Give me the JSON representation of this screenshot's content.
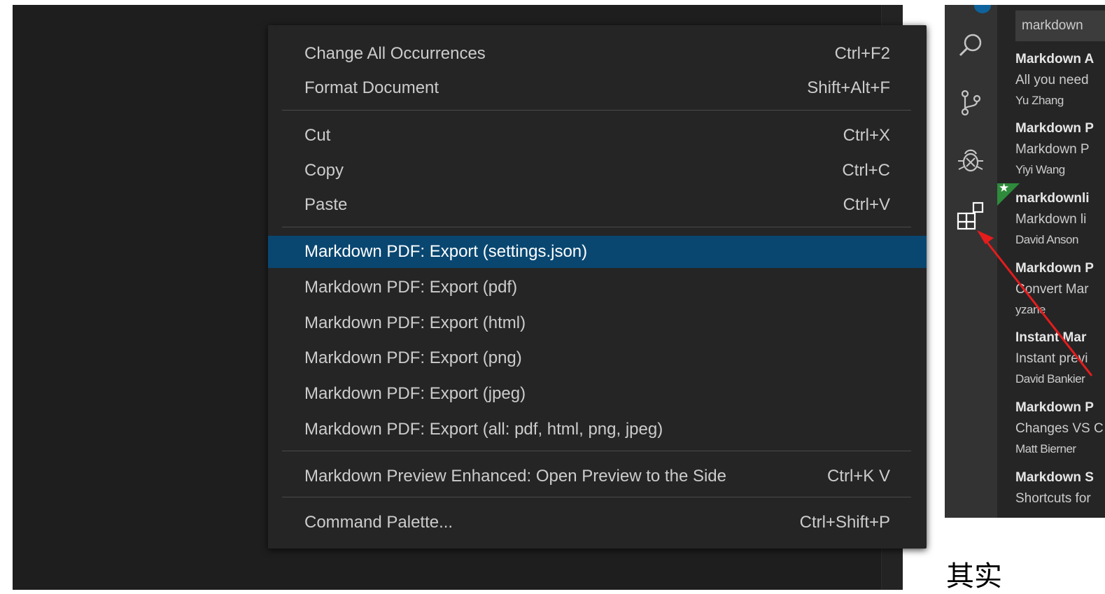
{
  "menu": {
    "items": [
      {
        "label": "Change All Occurrences",
        "shortcut": "Ctrl+F2"
      },
      {
        "label": "Format Document",
        "shortcut": "Shift+Alt+F"
      },
      {
        "label": "Cut",
        "shortcut": "Ctrl+X"
      },
      {
        "label": "Copy",
        "shortcut": "Ctrl+C"
      },
      {
        "label": "Paste",
        "shortcut": "Ctrl+V"
      },
      {
        "label": "Markdown PDF: Export (settings.json)",
        "shortcut": ""
      },
      {
        "label": "Markdown PDF: Export (pdf)",
        "shortcut": ""
      },
      {
        "label": "Markdown PDF: Export (html)",
        "shortcut": ""
      },
      {
        "label": "Markdown PDF: Export (png)",
        "shortcut": ""
      },
      {
        "label": "Markdown PDF: Export (jpeg)",
        "shortcut": ""
      },
      {
        "label": "Markdown PDF: Export (all: pdf, html, png, jpeg)",
        "shortcut": ""
      },
      {
        "label": "Markdown Preview Enhanced: Open Preview to the Side",
        "shortcut": "Ctrl+K V"
      },
      {
        "label": "Command Palette...",
        "shortcut": "Ctrl+Shift+P"
      }
    ],
    "active_item": "Markdown PDF: Export (settings.json)",
    "colors": {
      "background": "#252526",
      "highlight": "#094771",
      "text": "#cccccc"
    }
  },
  "sidebar": {
    "activity_icons": [
      "search-icon",
      "source-control-icon",
      "debug-icon",
      "extensions-icon"
    ],
    "search_value": "markdown",
    "extensions": [
      {
        "title": "Markdown A",
        "description": "All you need",
        "publisher": "Yu Zhang"
      },
      {
        "title": "Markdown P",
        "description": "Markdown P",
        "publisher": "Yiyi Wang"
      },
      {
        "title": "markdownli",
        "description": "Markdown li",
        "publisher": "David Anson"
      },
      {
        "title": "Markdown P",
        "description": "Convert Mar",
        "publisher": "yzane"
      },
      {
        "title": "Instant Mar",
        "description": "Instant previ",
        "publisher": "David Bankier"
      },
      {
        "title": "Markdown P",
        "description": "Changes VS C",
        "publisher": "Matt Bierner"
      },
      {
        "title": "Markdown S",
        "description": "Shortcuts for",
        "publisher": ""
      }
    ]
  },
  "caption": "其实"
}
